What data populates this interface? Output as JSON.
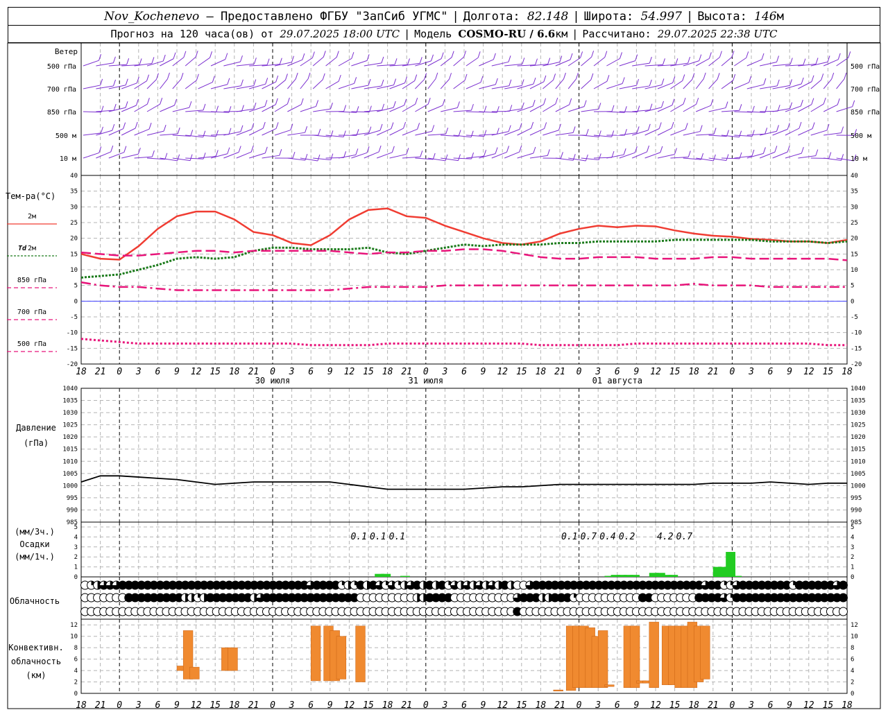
{
  "header": {
    "station": "Nov_Kochenevo",
    "provider": "— Предоставлено ФГБУ \"ЗапСиб УГМС\"",
    "lon_label": "Долгота:",
    "lon": "82.148",
    "lat_label": "Широта:",
    "lat": "54.997",
    "alt_label": "Высота:",
    "alt": "146",
    "alt_unit": "м",
    "forecast_label": "Прогноз на 120 часа(ов) от",
    "forecast_time": "29.07.2025 18:00 UTC",
    "model_label": "Модель",
    "model": "COSMO-RU / 6.6",
    "model_unit": "км",
    "calc_label": "Рассчитано:",
    "calc_time": "29.07.2025 22:38 UTC"
  },
  "labels": {
    "wind": "Ветер",
    "temp": "Тем-ра(°C)",
    "t2m": "2м",
    "td": "Td",
    "td2": "2м",
    "t850": "850 гПа",
    "t700": "700 гПа",
    "t500": "500 гПа",
    "pressure": "Давление",
    "pressure_unit": "(гПа)",
    "precip_unit3": "(мм/3ч.)",
    "precip": "Осадки",
    "precip_unit1": "(мм/1ч.)",
    "cloud": "Облачность",
    "conv1": "Конвективн.",
    "conv2": "облачность",
    "conv3": "(км)"
  },
  "wind_levels": [
    "500 гПа",
    "700 гПа",
    "850 гПа",
    "500 м",
    "10 м"
  ],
  "time_ticks": [
    "18",
    "21",
    "0",
    "3",
    "6",
    "9",
    "12",
    "15",
    "18",
    "21",
    "0",
    "3",
    "6",
    "9",
    "12",
    "15",
    "18",
    "21",
    "0",
    "3",
    "6",
    "9",
    "12",
    "15",
    "18",
    "21",
    "0"
  ],
  "dates": [
    "30 июля",
    "31 июля",
    "01 августа"
  ],
  "colors": {
    "wind": "#7b2fd0",
    "t2m": "#f03c32",
    "td": "#1a7a1a",
    "t850": "#e8147a",
    "t700": "#e8147a",
    "t500": "#e8147a",
    "zero": "#4040ff",
    "precip": "#22cc22",
    "conv": "#f08a30",
    "grid": "#b4b4b4"
  },
  "chart_data": [
    {
      "type": "line",
      "name": "temperature",
      "x_hours": [
        0,
        3,
        6,
        9,
        12,
        15,
        18,
        21,
        24,
        27,
        30,
        33,
        36,
        39,
        42,
        45,
        48,
        51,
        54,
        57,
        60,
        63,
        66,
        69,
        72,
        75,
        78,
        81,
        84,
        87,
        90,
        93,
        96,
        99,
        102,
        105,
        108,
        111,
        114,
        117,
        120
      ],
      "ylim": [
        -20,
        40
      ],
      "yticks": [
        -20,
        -15,
        -10,
        -5,
        0,
        5,
        10,
        15,
        20,
        25,
        30,
        35,
        40
      ],
      "series": [
        {
          "name": "2м",
          "values": [
            15,
            13.5,
            13.2,
            17.5,
            23,
            27,
            28.5,
            28.5,
            26,
            22,
            21,
            18.5,
            17.8,
            21,
            26,
            29,
            29.5,
            27,
            26.5,
            24,
            22,
            20,
            18.5,
            18,
            19,
            21.5,
            23,
            24,
            23.5,
            24,
            23.8,
            22.5,
            21.5,
            20.8,
            20.5,
            19.8,
            19.5,
            19,
            19,
            18.5,
            19.5
          ]
        },
        {
          "name": "Td 2м",
          "values": [
            7.5,
            8,
            8.5,
            10,
            11.5,
            13.5,
            14,
            13.5,
            14,
            16,
            17,
            17,
            16.5,
            16.5,
            16.5,
            17,
            15.5,
            15,
            16,
            17,
            18,
            17.5,
            18,
            18,
            18,
            18.5,
            18.5,
            19,
            19,
            19,
            19,
            19.5,
            19.5,
            19.5,
            19.5,
            19.5,
            19,
            19,
            19,
            18.5,
            19
          ]
        },
        {
          "name": "850 гПа",
          "values": [
            15.5,
            15,
            14.5,
            14.5,
            15,
            15.5,
            16,
            16,
            15.5,
            16,
            16,
            16,
            16,
            16,
            15.5,
            15,
            15.5,
            15.5,
            16,
            16,
            16.5,
            16.5,
            16,
            15,
            14,
            13.5,
            13.5,
            14,
            14,
            14,
            13.5,
            13.5,
            13.5,
            14,
            14,
            13.5,
            13.5,
            13.5,
            13.5,
            13.5,
            13
          ]
        },
        {
          "name": "700 гПа",
          "values": [
            6,
            5,
            4.5,
            4.5,
            4,
            3.5,
            3.5,
            3.5,
            3.5,
            3.5,
            3.5,
            3.5,
            3.5,
            3.5,
            4,
            4.5,
            4.5,
            4.5,
            4.5,
            5,
            5,
            5,
            5,
            5,
            5,
            5,
            5,
            5,
            5,
            5,
            5,
            5,
            5.5,
            5,
            5,
            5,
            4.5,
            4.5,
            4.5,
            4.5,
            4.5
          ]
        },
        {
          "name": "500 гПа",
          "values": [
            -12,
            -12.5,
            -13,
            -13.5,
            -13.5,
            -13.5,
            -13.5,
            -13.5,
            -13.5,
            -13.5,
            -13.5,
            -13.5,
            -14,
            -14,
            -14,
            -14,
            -13.5,
            -13.5,
            -13.5,
            -13.5,
            -13.5,
            -13.5,
            -13.5,
            -13.5,
            -14,
            -14,
            -14,
            -14,
            -14,
            -13.5,
            -13.5,
            -13.5,
            -13.5,
            -13.5,
            -13.5,
            -13.5,
            -13.5,
            -13.5,
            -13.5,
            -14,
            -14
          ]
        }
      ]
    },
    {
      "type": "line",
      "name": "pressure",
      "x_hours": [
        0,
        3,
        6,
        9,
        12,
        15,
        18,
        21,
        24,
        27,
        30,
        33,
        36,
        39,
        42,
        45,
        48,
        51,
        54,
        57,
        60,
        63,
        66,
        69,
        72,
        75,
        78,
        81,
        84,
        87,
        90,
        93,
        96,
        99,
        102,
        105,
        108,
        111,
        114,
        117,
        120
      ],
      "ylim": [
        985,
        1040
      ],
      "yticks": [
        985,
        990,
        995,
        1000,
        1005,
        1010,
        1015,
        1020,
        1025,
        1030,
        1035,
        1040
      ],
      "values": [
        1001.5,
        1004,
        1004,
        1003.5,
        1003,
        1002.5,
        1001.5,
        1000.5,
        1001,
        1001.5,
        1001.5,
        1001.5,
        1001.5,
        1001.5,
        1000.5,
        999.5,
        998.5,
        998.5,
        998.5,
        998.5,
        998.5,
        999,
        999.5,
        999.5,
        1000,
        1000.5,
        1000.5,
        1000.5,
        1000.5,
        1000.5,
        1000.5,
        1000.5,
        1000.5,
        1001,
        1001,
        1001,
        1001.5,
        1001,
        1000.5,
        1001,
        1001
      ]
    },
    {
      "type": "bar",
      "name": "precipitation",
      "ylim": [
        0,
        5
      ],
      "yticks": [
        0,
        1,
        2,
        3,
        4,
        5
      ],
      "x_hours": [
        46,
        47,
        50,
        82,
        83,
        84,
        85,
        86,
        89,
        90,
        91,
        92,
        99,
        100,
        101,
        102
      ],
      "values": [
        0.3,
        0.3,
        0.1,
        0.1,
        0.2,
        0.2,
        0.2,
        0.2,
        0.4,
        0.4,
        0.2,
        0.2,
        1,
        1,
        2.5,
        0.1
      ],
      "labels_3h": [
        {
          "x_hour": 43.5,
          "text": "0.1"
        },
        {
          "x_hour": 46.5,
          "text": "0.1"
        },
        {
          "x_hour": 49.5,
          "text": "0.1"
        },
        {
          "x_hour": 76.5,
          "text": "0.1"
        },
        {
          "x_hour": 79.5,
          "text": "0.7"
        },
        {
          "x_hour": 82.5,
          "text": "0.4"
        },
        {
          "x_hour": 85.5,
          "text": "0.2"
        },
        {
          "x_hour": 91.5,
          "text": "4.2"
        },
        {
          "x_hour": 94.5,
          "text": "0.7"
        }
      ]
    },
    {
      "type": "bar",
      "name": "convective_cloud",
      "ylim": [
        0,
        13
      ],
      "yticks": [
        0,
        2,
        4,
        6,
        8,
        10,
        12
      ],
      "bars": [
        {
          "x_hour": 15,
          "bottom": 4,
          "top": 4.8
        },
        {
          "x_hour": 16,
          "bottom": 2.5,
          "top": 11
        },
        {
          "x_hour": 17,
          "bottom": 2.5,
          "top": 4.6
        },
        {
          "x_hour": 22,
          "bottom": 4,
          "top": 8
        },
        {
          "x_hour": 23,
          "bottom": 4,
          "top": 8
        },
        {
          "x_hour": 36,
          "bottom": 2.2,
          "top": 11.8
        },
        {
          "x_hour": 38,
          "bottom": 2.2,
          "top": 11.8
        },
        {
          "x_hour": 39,
          "bottom": 2.2,
          "top": 11
        },
        {
          "x_hour": 40,
          "bottom": 2.5,
          "top": 10
        },
        {
          "x_hour": 43,
          "bottom": 2,
          "top": 11.8
        },
        {
          "x_hour": 74,
          "bottom": 0.4,
          "top": 0.6
        },
        {
          "x_hour": 76,
          "bottom": 0.5,
          "top": 11.8
        },
        {
          "x_hour": 77,
          "bottom": 1,
          "top": 11.8
        },
        {
          "x_hour": 78,
          "bottom": 1,
          "top": 11.8
        },
        {
          "x_hour": 79,
          "bottom": 1,
          "top": 11.5
        },
        {
          "x_hour": 80,
          "bottom": 1,
          "top": 10
        },
        {
          "x_hour": 81,
          "bottom": 1,
          "top": 11
        },
        {
          "x_hour": 82,
          "bottom": 1.2,
          "top": 1.5
        },
        {
          "x_hour": 85,
          "bottom": 1,
          "top": 11.8
        },
        {
          "x_hour": 86,
          "bottom": 1,
          "top": 11.8
        },
        {
          "x_hour": 87,
          "bottom": 1.8,
          "top": 2.2
        },
        {
          "x_hour": 88,
          "bottom": 1.8,
          "top": 2.2
        },
        {
          "x_hour": 89,
          "bottom": 1,
          "top": 12.5
        },
        {
          "x_hour": 91,
          "bottom": 1.5,
          "top": 11.8
        },
        {
          "x_hour": 92,
          "bottom": 1.5,
          "top": 11.8
        },
        {
          "x_hour": 93,
          "bottom": 1,
          "top": 11.8
        },
        {
          "x_hour": 94,
          "bottom": 1,
          "top": 11.8
        },
        {
          "x_hour": 95,
          "bottom": 1,
          "top": 12.5
        },
        {
          "x_hour": 96,
          "bottom": 2,
          "top": 11.8
        },
        {
          "x_hour": 97,
          "bottom": 2.5,
          "top": 11.8
        }
      ]
    }
  ],
  "cloud_rows": [
    "01233344444444444444444444444444444434444121424313123424241323232324200344444444444444444444444444434411344444444144444434",
    "00000004444444442212444444423444444444444444000000000224444000000000034442244410000000000440000000444431444444444444444444",
    "00000000000000000000000000000000000000000000000000000000000000000000040000000000000000000000000000000000000000000000000000"
  ]
}
